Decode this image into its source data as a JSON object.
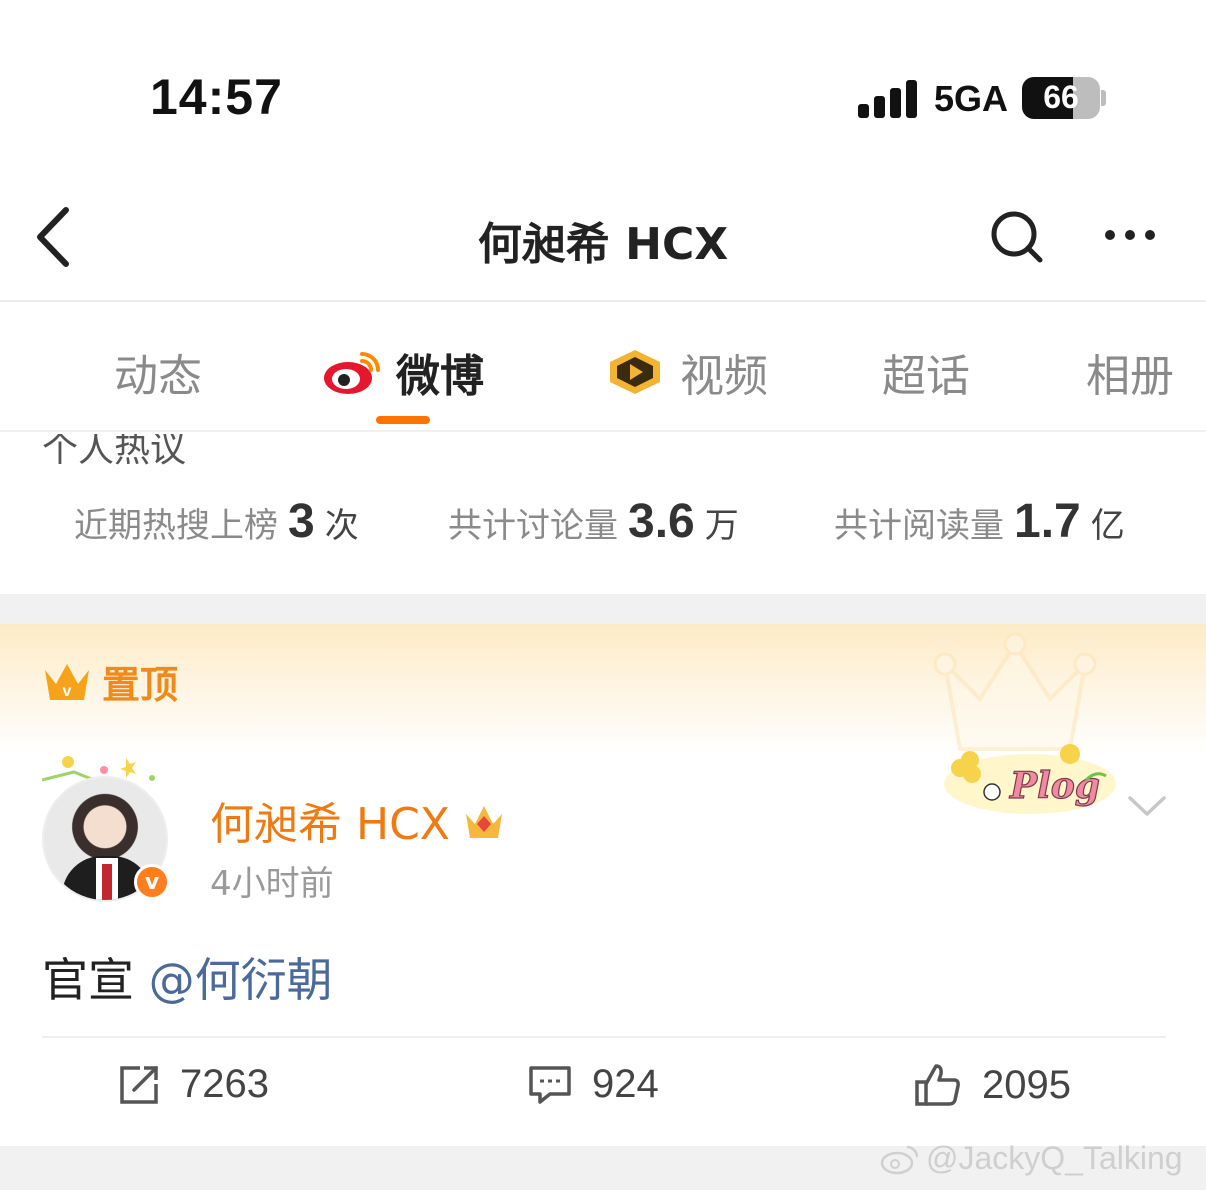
{
  "status_bar": {
    "time": "14:57",
    "network": "5GA",
    "battery": "66",
    "battery_level": 0.66
  },
  "navbar": {
    "title": "何昶希 HCX"
  },
  "tabs": [
    {
      "label": "动态",
      "active": false
    },
    {
      "label": "微博",
      "active": true
    },
    {
      "label": "视频",
      "active": false
    },
    {
      "label": "超话",
      "active": false
    },
    {
      "label": "相册",
      "active": false
    }
  ],
  "hot_section": {
    "title": "个人热议",
    "stats": [
      {
        "label": "近期热搜上榜",
        "value": "3",
        "unit": "次"
      },
      {
        "label": "共计讨论量",
        "value": "3.6",
        "unit": "万"
      },
      {
        "label": "共计阅读量",
        "value": "1.7",
        "unit": "亿"
      }
    ]
  },
  "pinned": {
    "label": "置顶"
  },
  "post": {
    "author": "何昶希 HCX",
    "time": "4小时前",
    "text": "官宣",
    "mention": "@何衍朝",
    "reposts": "7263",
    "comments": "924",
    "likes": "2095"
  },
  "watermark": "@JackyQ_Talking",
  "colors": {
    "accent": "#ff7300",
    "author_name": "#f07a12",
    "mention": "#4b6a9a"
  }
}
